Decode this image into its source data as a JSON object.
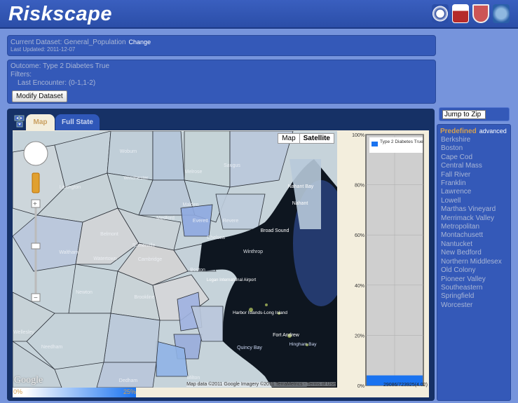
{
  "header": {
    "title": "Riskscape",
    "seals": [
      "hospital-seal",
      "dpm-seal",
      "harvard-seal",
      "state-seal"
    ]
  },
  "dataset": {
    "current": "Current Dataset: General_Population",
    "change_label": "Change",
    "last_updated": "Last Updated: 2011-12-07"
  },
  "outcome": {
    "outcome": "Outcome: Type 2 Diabetes True",
    "filters_label": "Filters:",
    "filter": "Last Encounter: (0-1,1-2)",
    "modify_label": "Modify Dataset"
  },
  "tabs": [
    {
      "label": "Map",
      "active": true
    },
    {
      "label": "Full State",
      "active": false
    }
  ],
  "map": {
    "type_map": "Map",
    "type_satellite": "Satellite",
    "selected_type": "Satellite",
    "attribution": "Map data ©2011 Google Imagery ©2011 TerraMetrics - ",
    "terms": "Terms of Use",
    "google": "Google",
    "places": [
      "Woburn",
      "Lexington",
      "Winchester",
      "Melrose",
      "Saugus",
      "Malden",
      "Medford",
      "Everett",
      "Revere",
      "Belmont",
      "Somerville",
      "Chelsea",
      "Waltham",
      "Watertown",
      "Cambridge",
      "Winthrop",
      "Boston",
      "Newton",
      "Brookline",
      "Logan International Airport",
      "Broad Sound",
      "Nahant Bay",
      "Nahant",
      "Harbor Islands-Long Island",
      "Fort Andrew",
      "Quincy Bay",
      "Hingham Bay",
      "Needham",
      "Wellesley",
      "Dedham",
      "Milton"
    ],
    "legend": {
      "min": "0%",
      "max": "25%",
      "color_low": "#ffffff",
      "color_high": "#1a73f0"
    }
  },
  "chart_data": {
    "type": "bar",
    "categories": [
      ""
    ],
    "series": [
      {
        "name": "Type 2 Diabetes True",
        "values": [
          4.02
        ]
      }
    ],
    "ylim": [
      0,
      100
    ],
    "yticks": [
      "0%",
      "20%",
      "40%",
      "60%",
      "80%",
      "100%"
    ],
    "legend": "top-right",
    "grid": true,
    "footer": "29086/723925(4.02)",
    "color": "#1a73f0"
  },
  "sidebar": {
    "jump_label": "Jump to Zip",
    "predefined": "Predefined",
    "advanced": "advanced",
    "regions": [
      "Berkshire",
      "Boston",
      "Cape Cod",
      "Central Mass",
      "Fall River",
      "Franklin",
      "Lawrence",
      "Lowell",
      "Marthas Vineyard",
      "Merrimack Valley",
      "Metropolitan",
      "Montachusett",
      "Nantucket",
      "New Bedford",
      "Northern Middlesex",
      "Old Colony",
      "Pioneer Valley",
      "Southeastern",
      "Springfield",
      "Worcester"
    ]
  }
}
